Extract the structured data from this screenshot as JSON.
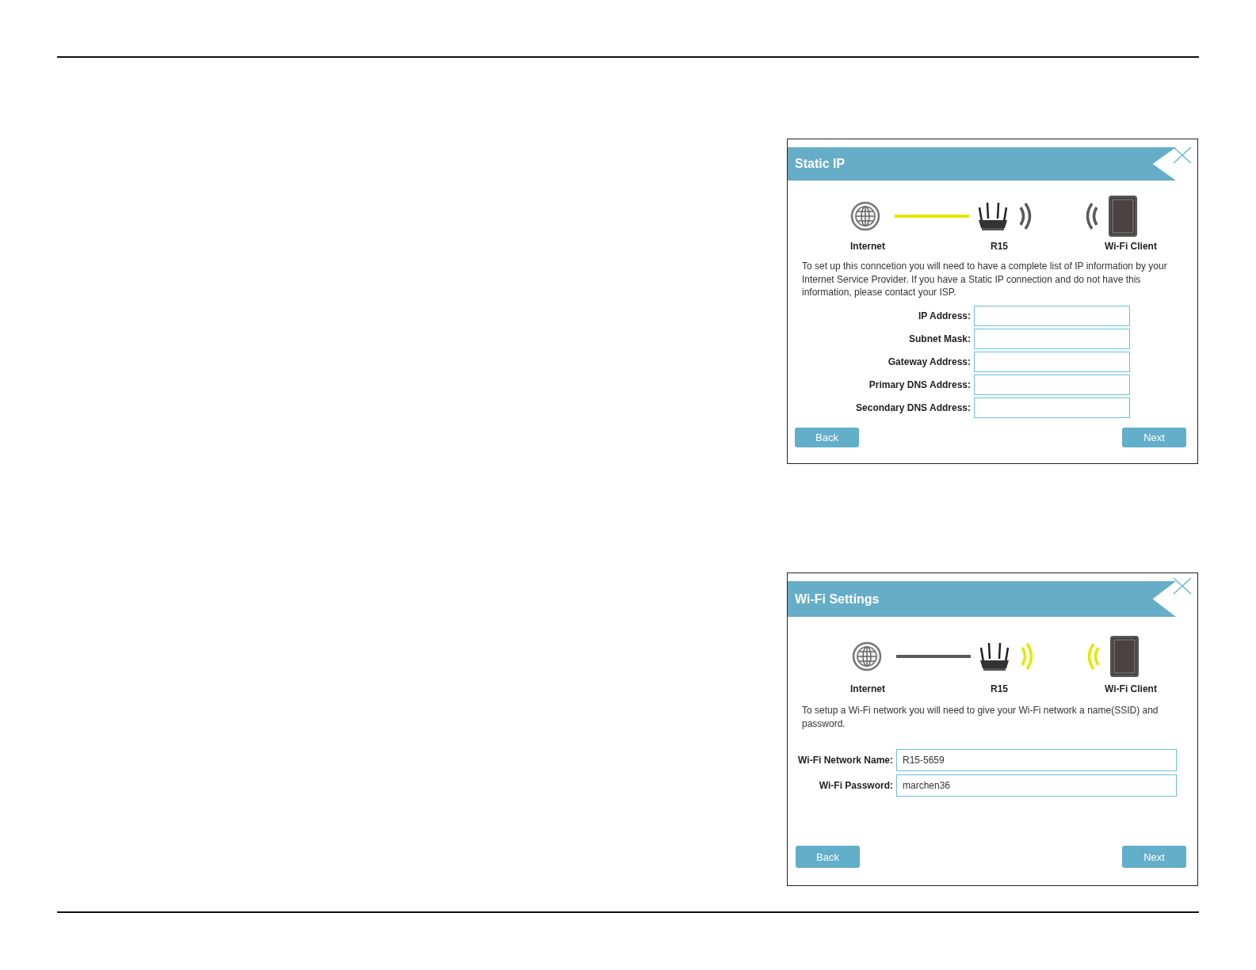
{
  "dialogs": [
    {
      "kind": "wan",
      "title": "Static IP",
      "diagram": {
        "wired_active": true,
        "wireless_active": false,
        "nodes": [
          {
            "label": "Internet"
          },
          {
            "label": "R15"
          },
          {
            "label": "Wi-Fi Client"
          }
        ]
      },
      "description": "To set up this conncetion you will need to have a complete list of IP information by your Internet Service Provider. If you have a Static IP connection and do not have this information, please contact your ISP.",
      "fields": [
        {
          "label": "IP Address:"
        },
        {
          "label": "Subnet Mask:"
        },
        {
          "label": "Gateway Address:"
        },
        {
          "label": "Primary DNS Address:"
        },
        {
          "label": "Secondary DNS Address:"
        }
      ],
      "buttons": [
        "Back",
        "Next"
      ]
    },
    {
      "kind": "wifi",
      "title": "Wi-Fi Settings",
      "diagram": {
        "wired_active": false,
        "wireless_active": true,
        "nodes": [
          {
            "label": "Internet"
          },
          {
            "label": "R15"
          },
          {
            "label": "Wi-Fi Client"
          }
        ]
      },
      "description": "To setup a Wi-Fi network you will need to give your Wi-Fi network a name(SSID) and password.",
      "fields": [
        {
          "label": "Wi-Fi Network Name:",
          "value": "R15-5659"
        },
        {
          "label": "Wi-Fi Password:",
          "value": "marchen36"
        }
      ],
      "buttons": [
        "Back",
        "Next"
      ]
    }
  ]
}
